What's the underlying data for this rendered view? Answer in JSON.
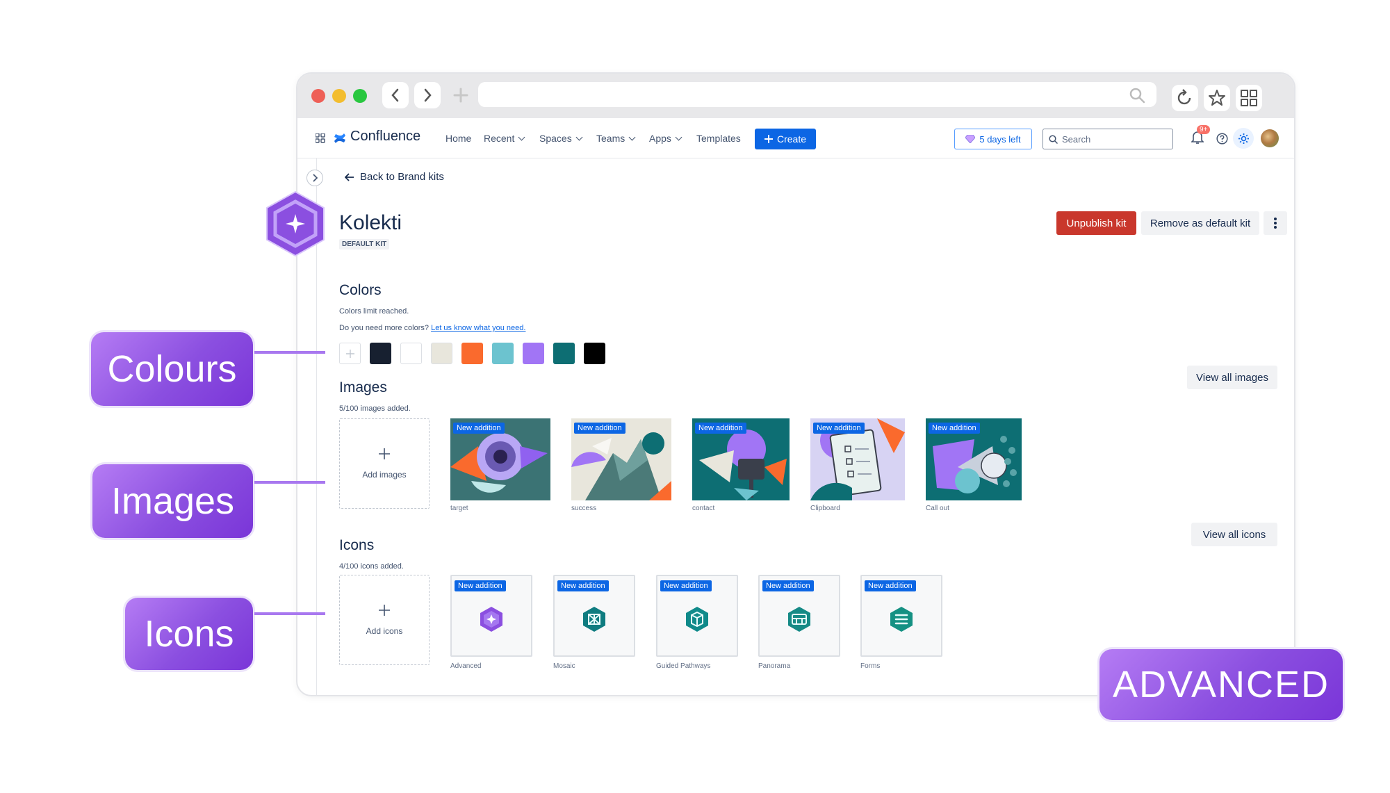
{
  "topbar": {
    "app_name": "Confluence",
    "nav": [
      "Home",
      "Recent",
      "Spaces",
      "Teams",
      "Apps",
      "Templates"
    ],
    "create_label": "Create",
    "trial_label": "5 days left",
    "search_placeholder": "Search",
    "notification_count": "9+"
  },
  "page": {
    "back_label": "Back to Brand kits",
    "kit_name": "Kolekti",
    "kit_badge": "DEFAULT KIT",
    "unpublish_label": "Unpublish kit",
    "remove_default_label": "Remove as default kit"
  },
  "colors": {
    "title": "Colors",
    "limit_text": "Colors limit reached.",
    "question_text": "Do you need more colors?",
    "link_text": "Let us know what you need.",
    "swatches": [
      "#172030",
      "#ffffff",
      "#e8e6dc",
      "#fa6a2d",
      "#6cc3cf",
      "#a175f5",
      "#0d6e73",
      "#000000"
    ]
  },
  "images": {
    "title": "Images",
    "count_text": "5/100 images added.",
    "add_label": "Add images",
    "view_all_label": "View all images",
    "badge": "New addition",
    "items": [
      "target",
      "success",
      "contact",
      "Clipboard",
      "Call out"
    ]
  },
  "icons": {
    "title": "Icons",
    "count_text": "4/100 icons added.",
    "add_label": "Add icons",
    "view_all_label": "View all icons",
    "badge": "New addition",
    "items": [
      "Advanced",
      "Mosaic",
      "Guided Pathways",
      "Panorama",
      "Forms"
    ]
  },
  "callouts": {
    "colours": "Colours",
    "images": "Images",
    "icons": "Icons",
    "advanced": "ADVANCED"
  },
  "accent": "#8b4fe0"
}
